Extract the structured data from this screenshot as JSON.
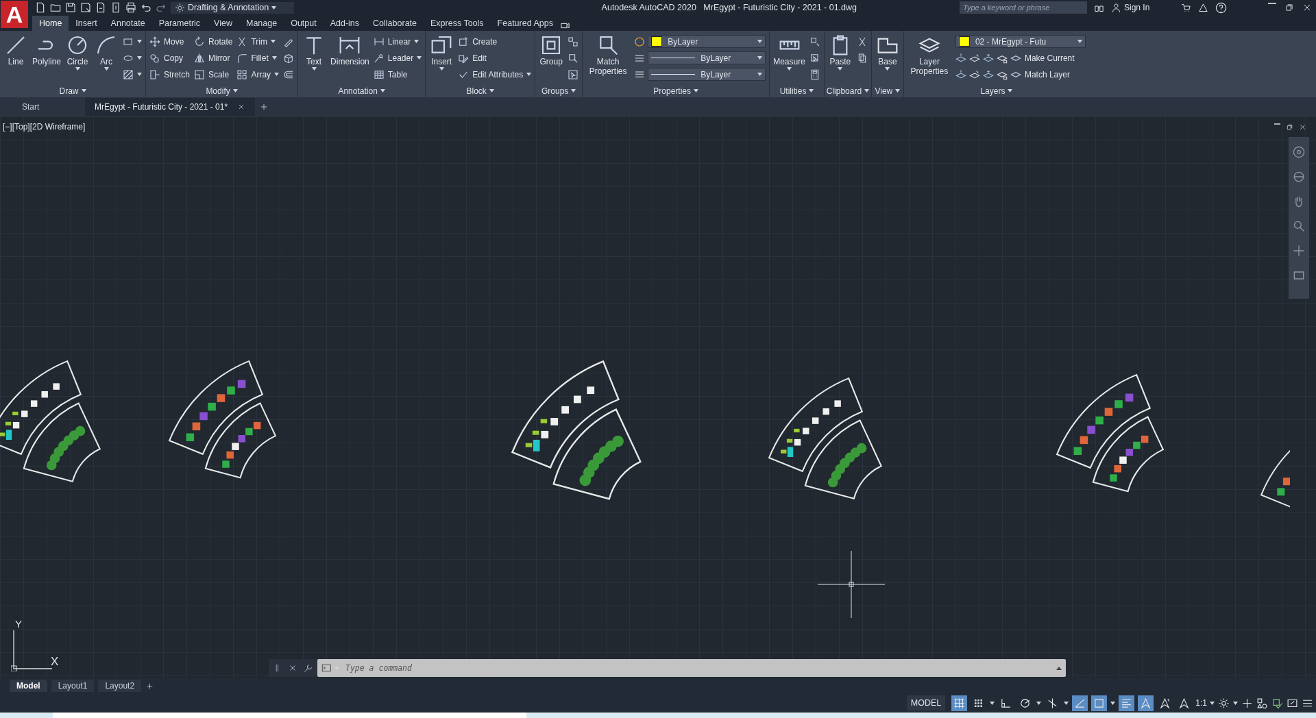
{
  "app": {
    "logo": "A",
    "workspace": "Drafting & Annotation",
    "title": "Autodesk AutoCAD 2020",
    "file": "MrEgypt - Futuristic City - 2021 - 01.dwg",
    "search_placeholder": "Type a keyword or phrase",
    "sign_in": "Sign In"
  },
  "ribbon_tabs": [
    {
      "label": "Home",
      "selected": true
    },
    {
      "label": "Insert",
      "selected": false
    },
    {
      "label": "Annotate",
      "selected": false
    },
    {
      "label": "Parametric",
      "selected": false
    },
    {
      "label": "View",
      "selected": false
    },
    {
      "label": "Manage",
      "selected": false
    },
    {
      "label": "Output",
      "selected": false
    },
    {
      "label": "Add-ins",
      "selected": false
    },
    {
      "label": "Collaborate",
      "selected": false
    },
    {
      "label": "Express Tools",
      "selected": false
    },
    {
      "label": "Featured Apps",
      "selected": false
    }
  ],
  "panels": [
    {
      "title": "Draw",
      "columns": [
        {
          "kind": "large",
          "label": "Line",
          "dropdown": false
        },
        {
          "kind": "large",
          "label": "Polyline",
          "dropdown": false
        },
        {
          "kind": "large",
          "label": "Circle",
          "dropdown": true
        },
        {
          "kind": "large",
          "label": "Arc",
          "dropdown": true
        },
        {
          "kind": "stack",
          "items": [
            {
              "kind": "tool",
              "dropdown": true
            },
            {
              "kind": "tool",
              "dropdown": true
            },
            {
              "kind": "tool",
              "dropdown": true
            }
          ]
        }
      ]
    },
    {
      "title": "Modify",
      "columns": [
        {
          "kind": "stack",
          "items": [
            {
              "kind": "tool",
              "label": "Move",
              "dropdown": false
            },
            {
              "kind": "tool",
              "label": "Copy",
              "dropdown": false
            },
            {
              "kind": "tool",
              "label": "Stretch",
              "dropdown": false
            }
          ]
        },
        {
          "kind": "stack",
          "items": [
            {
              "kind": "tool",
              "label": "Rotate",
              "dropdown": false
            },
            {
              "kind": "tool",
              "label": "Mirror",
              "dropdown": false
            },
            {
              "kind": "tool",
              "label": "Scale",
              "dropdown": false
            }
          ]
        },
        {
          "kind": "stack",
          "items": [
            {
              "kind": "tool",
              "label": "Trim",
              "dropdown": true
            },
            {
              "kind": "tool",
              "label": "Fillet",
              "dropdown": true
            },
            {
              "kind": "tool",
              "label": "Array",
              "dropdown": true
            }
          ]
        },
        {
          "kind": "stack",
          "items": [
            {
              "kind": "tool",
              "dropdown": false
            },
            {
              "kind": "tool",
              "dropdown": false
            },
            {
              "kind": "tool",
              "dropdown": false
            }
          ]
        }
      ]
    },
    {
      "title": "Annotation",
      "columns": [
        {
          "kind": "large",
          "label": "Text",
          "dropdown": true
        },
        {
          "kind": "large",
          "label": "Dimension",
          "dropdown": false
        },
        {
          "kind": "stack",
          "items": [
            {
              "kind": "tool",
              "label": "Linear",
              "dropdown": true
            },
            {
              "kind": "tool",
              "label": "Leader",
              "dropdown": true
            },
            {
              "kind": "tool",
              "label": "Table",
              "dropdown": false
            }
          ]
        }
      ]
    },
    {
      "title": "Block",
      "columns": [
        {
          "kind": "large",
          "label": "Insert",
          "dropdown": true
        },
        {
          "kind": "stack",
          "items": [
            {
              "kind": "tool",
              "label": "Create",
              "dropdown": false
            },
            {
              "kind": "tool",
              "label": "Edit",
              "dropdown": false
            },
            {
              "kind": "tool",
              "label": "Edit Attributes",
              "dropdown": true
            }
          ]
        }
      ]
    },
    {
      "title": "Groups",
      "columns": [
        {
          "kind": "large",
          "label": "Group",
          "dropdown": false
        },
        {
          "kind": "stack",
          "items": [
            {
              "kind": "tool",
              "dropdown": false
            },
            {
              "kind": "tool",
              "dropdown": false
            },
            {
              "kind": "tool",
              "dropdown": false
            }
          ]
        }
      ]
    },
    {
      "title": "Properties",
      "columns": [
        {
          "kind": "large",
          "label": "Match Properties",
          "dropdown": false
        },
        {
          "kind": "stack",
          "items": [
            {
              "kind": "color-dropdown",
              "label": "ByLayer",
              "color": "#ffff00"
            },
            {
              "kind": "line-dropdown",
              "label": "ByLayer"
            },
            {
              "kind": "line-dropdown",
              "label": "ByLayer"
            }
          ]
        }
      ]
    },
    {
      "title": "Utilities",
      "columns": [
        {
          "kind": "large",
          "label": "Measure",
          "dropdown": true
        },
        {
          "kind": "stack",
          "items": [
            {
              "kind": "tool",
              "dropdown": false
            },
            {
              "kind": "tool",
              "dropdown": false
            },
            {
              "kind": "tool",
              "dropdown": false
            }
          ]
        }
      ]
    },
    {
      "title": "Clipboard",
      "columns": [
        {
          "kind": "large",
          "label": "Paste",
          "dropdown": true
        },
        {
          "kind": "stack",
          "items": [
            {
              "kind": "tool",
              "dropdown": false
            },
            {
              "kind": "tool",
              "dropdown": false
            }
          ]
        }
      ]
    },
    {
      "title": "View",
      "columns": [
        {
          "kind": "large",
          "label": "Base",
          "dropdown": true
        }
      ]
    },
    {
      "title": "Layers",
      "columns": [
        {
          "kind": "large",
          "label": "Layer Properties",
          "dropdown": false
        },
        {
          "kind": "stack",
          "items": [
            {
              "kind": "color-dropdown",
              "label": "02 - MrEgypt - Futu",
              "color": "#ffff00"
            },
            {
              "kind": "layer-tool",
              "label": "Make Current"
            },
            {
              "kind": "layer-tool",
              "label": "Match Layer"
            }
          ]
        }
      ]
    }
  ],
  "doc_tabs": [
    {
      "label": "Start",
      "selected": false
    },
    {
      "label": "MrEgypt - Futuristic City - 2021 - 01*",
      "selected": true
    }
  ],
  "viewport": {
    "label": "[−][Top][2D Wireframe]",
    "ucs_x": "X",
    "ucs_y": "Y"
  },
  "command_line": {
    "placeholder": "Type a command"
  },
  "layout_tabs": [
    {
      "label": "Model",
      "selected": true
    },
    {
      "label": "Layout1",
      "selected": false
    },
    {
      "label": "Layout2",
      "selected": false
    }
  ],
  "status_bar": {
    "space": "MODEL",
    "scale": "1:1",
    "toggles": [
      {
        "on": true
      },
      {
        "on": false
      },
      {
        "on": false
      },
      {
        "on": false
      },
      {
        "on": false
      },
      {
        "on": true
      },
      {
        "on": true
      },
      {
        "on": true
      },
      {
        "on": true
      },
      {
        "on": false
      },
      {
        "on": false
      }
    ]
  }
}
